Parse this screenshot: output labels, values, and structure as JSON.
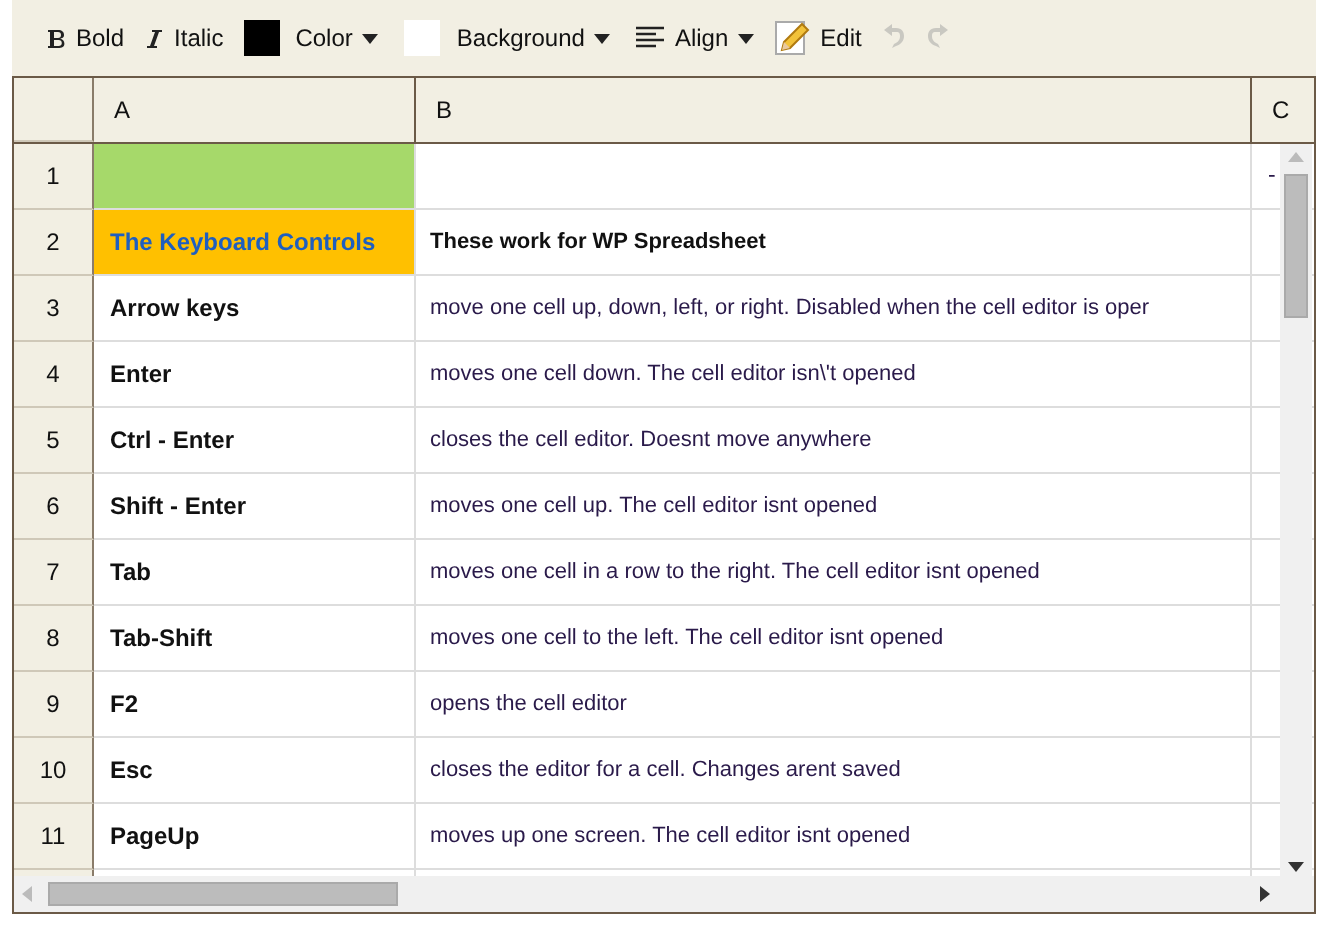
{
  "toolbar": [
    {
      "kind": "bold",
      "label": "Bold",
      "disabled": false
    },
    {
      "kind": "italic",
      "label": "Italic",
      "disabled": false
    },
    {
      "kind": "swatch",
      "label": "Color",
      "color": "#000000",
      "disabled": false
    },
    {
      "kind": "swatch",
      "label": "Background",
      "color": "#ffffff",
      "disabled": false
    },
    {
      "kind": "align",
      "label": "Align",
      "disabled": false
    },
    {
      "kind": "edit",
      "label": "Edit",
      "disabled": false
    },
    {
      "kind": "undo",
      "disabled": true
    },
    {
      "kind": "redo",
      "disabled": true
    }
  ],
  "columns": [
    "A",
    "B",
    "C"
  ],
  "rows": [
    {
      "number": "1",
      "cells": [
        {
          "kind": "plain",
          "color": "#a6d96a"
        },
        {
          "kind": "plain"
        },
        {
          "kind": "plain",
          "text": "-"
        }
      ]
    },
    {
      "number": "2",
      "cells": [
        {
          "kind": "title",
          "text": "The Keyboard Controls",
          "color": "#ffc000"
        },
        {
          "kind": "bold",
          "text": "These work for WP Spreadsheet"
        },
        {
          "kind": "plain"
        }
      ]
    },
    {
      "number": "3",
      "cells": [
        {
          "kind": "bold",
          "text": "Arrow keys"
        },
        {
          "kind": "plain",
          "text": "move one cell up, down, left, or right. Disabled when the cell editor is oper"
        },
        {
          "kind": "plain"
        }
      ]
    },
    {
      "number": "4",
      "cells": [
        {
          "kind": "bold",
          "text": "Enter"
        },
        {
          "kind": "plain",
          "text": "moves one cell down. The cell editor isn\\'t opened"
        },
        {
          "kind": "plain"
        }
      ]
    },
    {
      "number": "5",
      "cells": [
        {
          "kind": "bold",
          "text": "Ctrl - Enter"
        },
        {
          "kind": "plain",
          "text": "closes the cell editor. Doesnt move anywhere"
        },
        {
          "kind": "plain"
        }
      ]
    },
    {
      "number": "6",
      "cells": [
        {
          "kind": "bold",
          "text": "Shift - Enter"
        },
        {
          "kind": "plain",
          "text": "moves one cell up. The cell editor isnt opened"
        },
        {
          "kind": "plain"
        }
      ]
    },
    {
      "number": "7",
      "cells": [
        {
          "kind": "bold",
          "text": "Tab"
        },
        {
          "kind": "plain",
          "text": "moves one cell in a row to the right. The cell editor isnt opened"
        },
        {
          "kind": "plain"
        }
      ]
    },
    {
      "number": "8",
      "cells": [
        {
          "kind": "bold",
          "text": "Tab-Shift"
        },
        {
          "kind": "plain",
          "text": "moves one cell to the left. The cell editor isnt opened"
        },
        {
          "kind": "plain"
        }
      ]
    },
    {
      "number": "9",
      "cells": [
        {
          "kind": "bold",
          "text": "F2"
        },
        {
          "kind": "plain",
          "text": "opens the cell editor"
        },
        {
          "kind": "plain"
        }
      ]
    },
    {
      "number": "10",
      "cells": [
        {
          "kind": "bold",
          "text": "Esc"
        },
        {
          "kind": "plain",
          "text": "closes the editor for a cell. Changes arent saved"
        },
        {
          "kind": "plain"
        }
      ]
    },
    {
      "number": "11",
      "cells": [
        {
          "kind": "bold",
          "text": "PageUp"
        },
        {
          "kind": "plain",
          "text": "moves up one screen. The cell editor isnt opened"
        },
        {
          "kind": "plain"
        }
      ]
    }
  ]
}
